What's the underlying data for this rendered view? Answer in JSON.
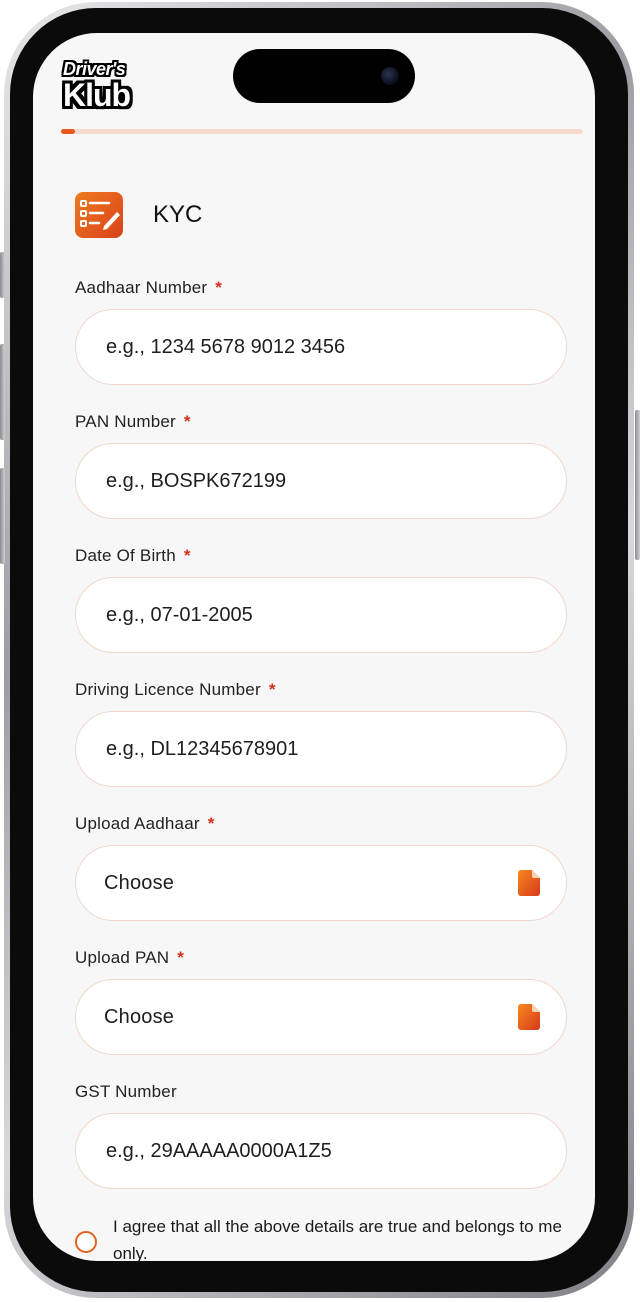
{
  "brand": {
    "logo_top": "Driver's",
    "logo_bottom": "Klub"
  },
  "progress": {
    "fraction": 0.027
  },
  "header": {
    "title": "KYC",
    "icon": "kyc-form-icon"
  },
  "form": {
    "aadhaar_number": {
      "label": "Aadhaar Number",
      "required_mark": "*",
      "placeholder": "e.g., 1234 5678 9012 3456"
    },
    "pan_number": {
      "label": "PAN Number",
      "required_mark": "*",
      "placeholder": "e.g., BOSPK672199"
    },
    "date_of_birth": {
      "label": "Date Of Birth",
      "required_mark": "*",
      "placeholder": "e.g., 07-01-2005"
    },
    "driving_licence_number": {
      "label": "Driving Licence Number",
      "required_mark": "*",
      "placeholder": "e.g., DL12345678901"
    },
    "upload_aadhaar": {
      "label": "Upload Aadhaar",
      "required_mark": "*",
      "value": "Choose",
      "icon": "file-icon"
    },
    "upload_pan": {
      "label": "Upload PAN",
      "required_mark": "*",
      "value": "Choose",
      "icon": "file-icon"
    },
    "gst_number": {
      "label": "GST Number",
      "placeholder": "e.g., 29AAAAA0000A1Z5"
    }
  },
  "agreement": {
    "text": "I agree that all the above details are true and belongs to me only."
  },
  "colors": {
    "accent": "#e85a1b",
    "required": "#d6301a",
    "background": "#f7f7f7"
  }
}
